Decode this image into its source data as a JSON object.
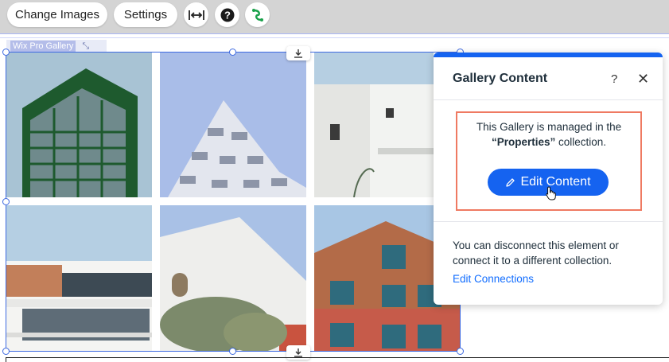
{
  "toolbar": {
    "change_images_label": "Change Images",
    "settings_label": "Settings",
    "stretch_icon": "stretch-arrows-icon",
    "help_icon": "help-icon",
    "connect_icon": "data-connection-icon"
  },
  "gallery": {
    "tag_label": "Wix Pro Gallery",
    "images": [
      "green-tower-building",
      "white-balconies-building",
      "white-modern-villa",
      "modern-house-balconies",
      "white-house-with-tree",
      "brick-wood-apartment"
    ]
  },
  "panel": {
    "title": "Gallery Content",
    "help_label": "?",
    "close_label": "✕",
    "message_line1": "This Gallery is managed in the",
    "collection_name": "“Properties”",
    "message_suffix": " collection.",
    "edit_button_label": "Edit Content",
    "info_text": "You can disconnect this element or connect it to a different collection.",
    "edit_connections_label": "Edit Connections"
  },
  "colors": {
    "accent": "#116dff",
    "highlight": "#ef7a62",
    "selection": "#3e6ae1"
  }
}
